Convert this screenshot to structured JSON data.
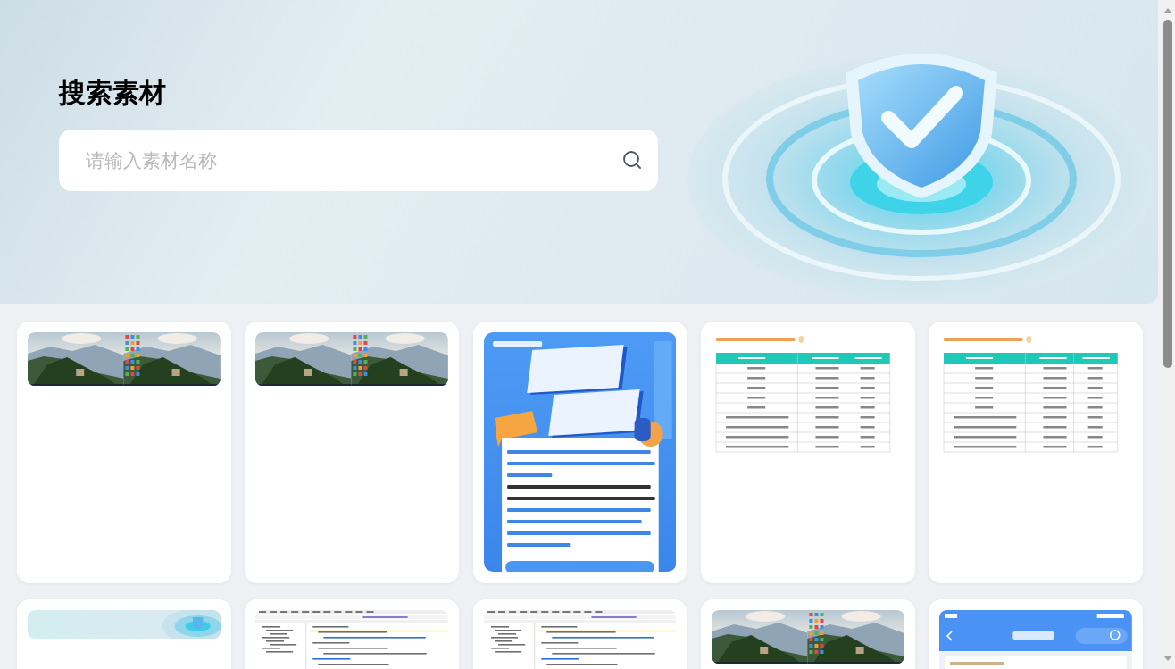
{
  "header": {
    "title": "搜索素材"
  },
  "search": {
    "placeholder": "请输入素材名称"
  },
  "materials": [
    {
      "kind": "landscape"
    },
    {
      "kind": "landscape"
    },
    {
      "kind": "poster"
    },
    {
      "kind": "table"
    },
    {
      "kind": "table"
    },
    {
      "kind": "banner"
    },
    {
      "kind": "code-editor"
    },
    {
      "kind": "code-editor"
    },
    {
      "kind": "landscape"
    },
    {
      "kind": "phone-app"
    }
  ]
}
